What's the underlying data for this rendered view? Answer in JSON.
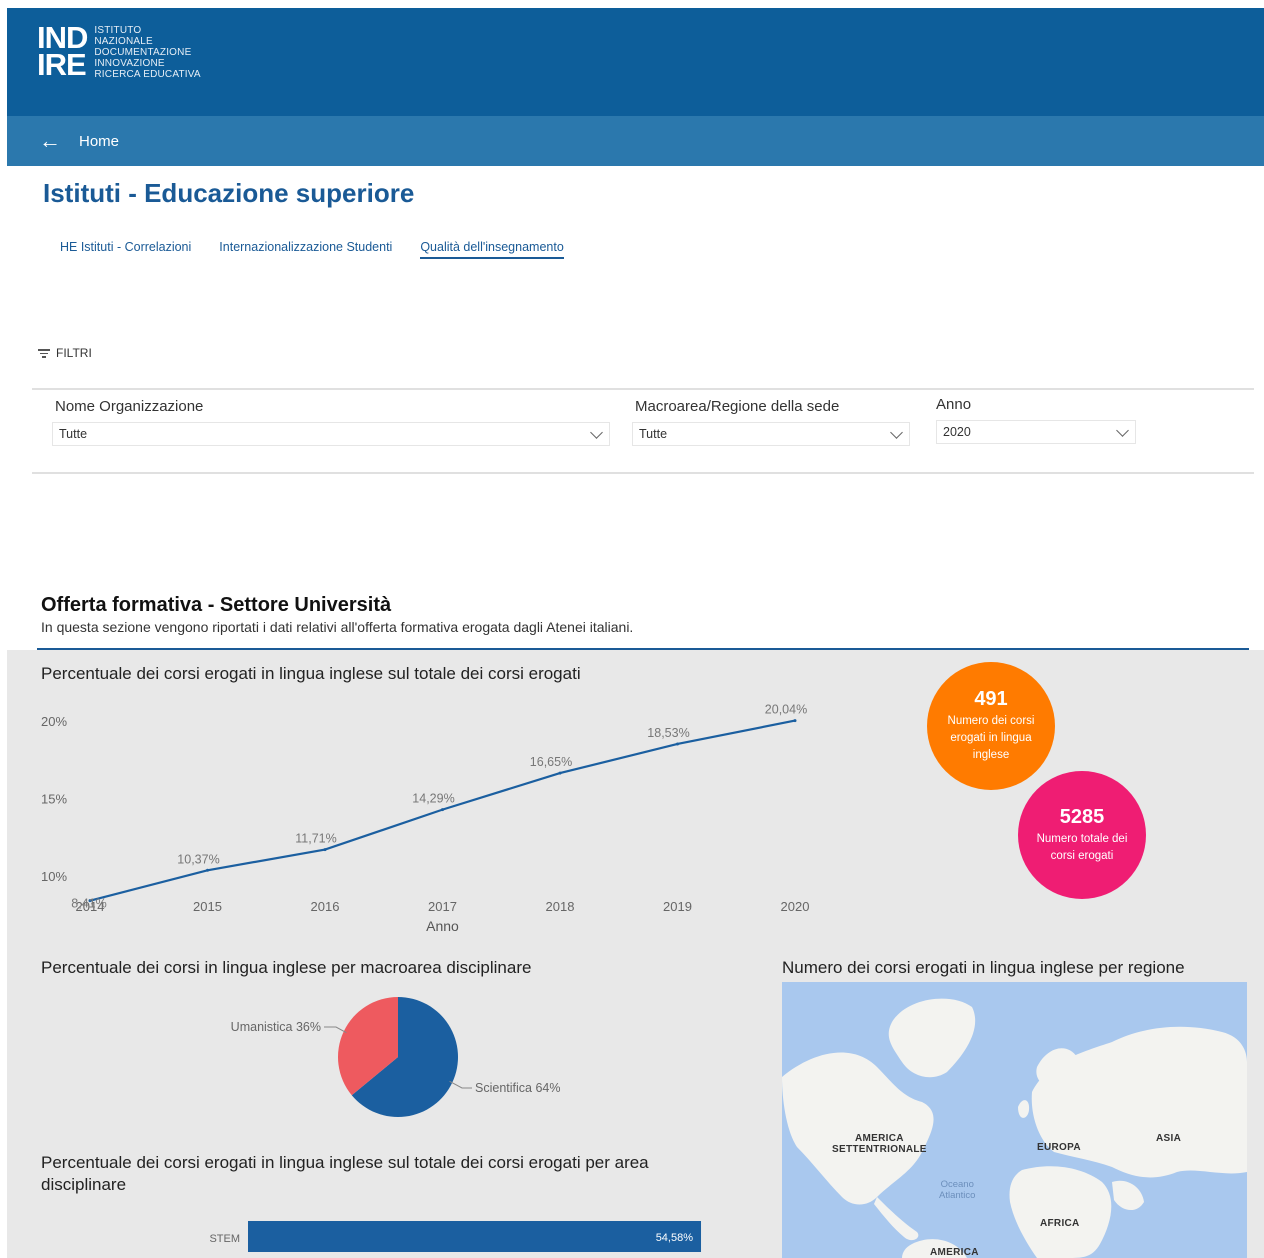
{
  "header": {
    "logo_top": "IND",
    "logo_bottom": "IRE",
    "logo_lines": [
      "ISTITUTO",
      "NAZIONALE",
      "DOCUMENTAZIONE",
      "INNOVAZIONE",
      "RICERCA EDUCATIVA"
    ]
  },
  "nav": {
    "home_label": "Home"
  },
  "page": {
    "title": "Istituti - Educazione superiore"
  },
  "tabs": [
    {
      "label": "HE Istituti - Correlazioni",
      "active": false
    },
    {
      "label": "Internazionalizzazione Studenti",
      "active": false
    },
    {
      "label": "Qualità dell'insegnamento",
      "active": true
    }
  ],
  "filters": {
    "toggle_label": "FILTRI",
    "org": {
      "label": "Nome Organizzazione",
      "value": "Tutte"
    },
    "region": {
      "label": "Macroarea/Regione della sede",
      "value": "Tutte"
    },
    "year": {
      "label": "Anno",
      "value": "2020"
    }
  },
  "section": {
    "title": "Offerta formativa - Settore Università",
    "description": "In questa sezione vengono riportati i dati relativi all'offerta formativa erogata dagli Atenei italiani."
  },
  "kpis": {
    "english_courses": {
      "value": "491",
      "label_lines": [
        "Numero dei corsi",
        "erogati in lingua",
        "inglese"
      ],
      "color": "#ff7b00"
    },
    "total_courses": {
      "value": "5285",
      "label_lines": [
        "Numero totale dei",
        "corsi erogati"
      ],
      "color": "#ef1d73"
    }
  },
  "map": {
    "title": "Numero dei corsi erogati in lingua inglese per regione",
    "labels": {
      "north_america": [
        "AMERICA",
        "SETTENTRIONALE"
      ],
      "europe": "EUROPA",
      "asia": "ASIA",
      "africa": "AFRICA",
      "south_america": "AMERICA",
      "ocean": [
        "Oceano",
        "Atlantico"
      ]
    }
  },
  "chart_data": [
    {
      "type": "line",
      "title": "Percentuale dei corsi erogati in lingua inglese sul totale dei corsi erogati",
      "xlabel": "Anno",
      "ylabel": "",
      "x": [
        "2014",
        "2015",
        "2016",
        "2017",
        "2018",
        "2019",
        "2020"
      ],
      "values": [
        8.41,
        10.37,
        11.71,
        14.29,
        16.65,
        18.53,
        20.04
      ],
      "data_labels": [
        "8,41%",
        "10,37%",
        "11,71%",
        "14,29%",
        "16,65%",
        "18,53%",
        "20,04%"
      ],
      "yticks": [
        10,
        15,
        20
      ],
      "ytick_labels": [
        "10%",
        "15%",
        "20%"
      ],
      "ylim": [
        8,
        21.5
      ],
      "grid": false,
      "color": "#1b5fa0"
    },
    {
      "type": "pie",
      "title": "Percentuale dei corsi in lingua inglese per macroarea disciplinare",
      "slices": [
        {
          "label": "Umanistica 36%",
          "value": 36,
          "color": "#ee5a5f"
        },
        {
          "label": "Scientifica 64%",
          "value": 64,
          "color": "#1b5fa0"
        }
      ]
    },
    {
      "type": "bar",
      "title": "Percentuale dei corsi erogati in lingua inglese sul totale dei corsi erogati per area disciplinare",
      "categories": [
        "STEM"
      ],
      "values": [
        54.58
      ],
      "data_labels": [
        "54,58%"
      ],
      "color": "#1b5fa0"
    }
  ]
}
